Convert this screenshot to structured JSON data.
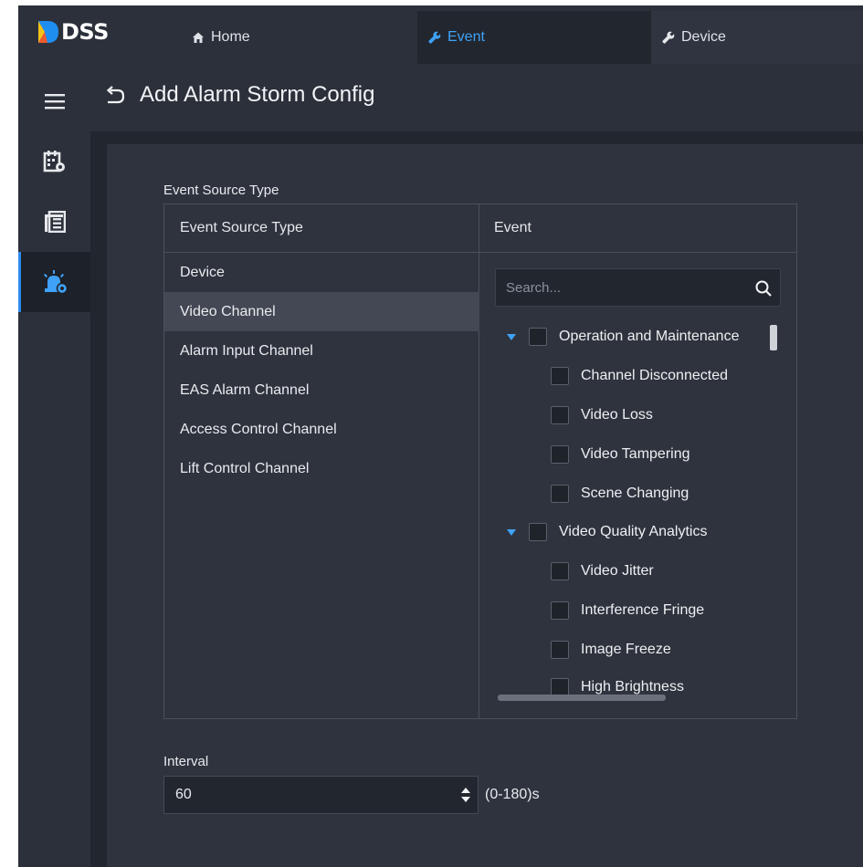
{
  "app": {
    "logo_text": "DSS"
  },
  "nav": {
    "tabs": [
      {
        "label": "Home",
        "icon": "home-icon"
      },
      {
        "label": "Event",
        "icon": "wrench-icon",
        "active": true
      },
      {
        "label": "Device",
        "icon": "wrench-icon"
      }
    ]
  },
  "rail": {
    "items": [
      {
        "icon": "menu-icon"
      },
      {
        "icon": "calendar-gear-icon"
      },
      {
        "icon": "list-icon"
      },
      {
        "icon": "alarm-gear-icon",
        "active": true
      }
    ]
  },
  "page": {
    "title": "Add Alarm Storm Config"
  },
  "event_source": {
    "section_label": "Event Source Type",
    "left_header": "Event Source Type",
    "right_header": "Event",
    "types": [
      "Device",
      "Video Channel",
      "Alarm Input Channel",
      "EAS Alarm Channel",
      "Access Control Channel",
      "Lift Control Channel"
    ],
    "selected_type": "Video Channel",
    "search_placeholder": "Search...",
    "tree": [
      {
        "label": "Operation and Maintenance",
        "group": true
      },
      {
        "label": "Channel Disconnected",
        "group": false
      },
      {
        "label": "Video Loss",
        "group": false
      },
      {
        "label": "Video Tampering",
        "group": false
      },
      {
        "label": "Scene Changing",
        "group": false
      },
      {
        "label": "Video Quality Analytics",
        "group": true
      },
      {
        "label": "Video Jitter",
        "group": false
      },
      {
        "label": "Interference Fringe",
        "group": false
      },
      {
        "label": "Image Freeze",
        "group": false
      },
      {
        "label": "High Brightness",
        "group": false
      }
    ]
  },
  "interval": {
    "label": "Interval",
    "value": "60",
    "range_note": "(0-180)s"
  },
  "colors": {
    "accent": "#3fa2f7",
    "background": "#22262e",
    "panel": "#2e333d"
  }
}
